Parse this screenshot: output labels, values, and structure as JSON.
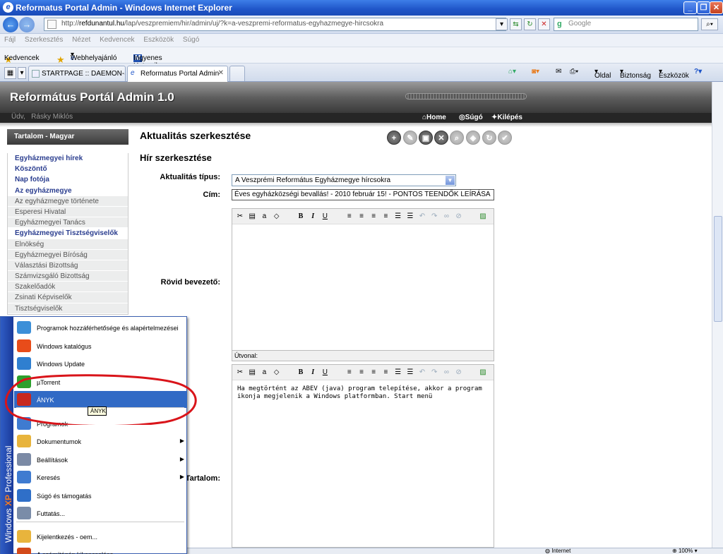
{
  "window": {
    "title": "Reformatus Portal Admin - Windows Internet Explorer"
  },
  "address": {
    "url_prefix": "http://",
    "url_host": "refdunantul.hu",
    "url_path": "/lap/veszpremiem/hir/admin/uj/?k=a-veszpremi-reformatus-egyhazmegye-hircsokra",
    "search_placeholder": "Google"
  },
  "menubar": [
    "Fájl",
    "Szerkesztés",
    "Nézet",
    "Kedvencek",
    "Eszközök",
    "Súgó"
  ],
  "favorites": {
    "label": "Kedvencek",
    "items": [
      "Webhelyajánló",
      "Ingyenes Hotmail"
    ]
  },
  "tabs": [
    {
      "label": "STARTPAGE :: DAEMON-Sea..."
    },
    {
      "label": "Reformatus Portal Admin"
    }
  ],
  "commandbar": [
    "Oldal",
    "Biztonság",
    "Eszközök"
  ],
  "portal": {
    "title": "Református Portál Admin 1.0",
    "greeting": "Üdv,",
    "user": "Rásky Miklós",
    "nav": [
      "Home",
      "Súgó",
      "Kilépés"
    ]
  },
  "sidebar": {
    "header": "Tartalom - Magyar",
    "items": [
      {
        "label": "Egyházmegyei hírek",
        "main": true
      },
      {
        "label": "Köszöntő",
        "main": true
      },
      {
        "label": "Nap fotója",
        "main": true
      },
      {
        "label": "Az egyházmegye",
        "main": true
      },
      {
        "label": "Az egyházmegye története",
        "main": false
      },
      {
        "label": "Esperesi Hivatal",
        "main": false
      },
      {
        "label": "Egyházmegyei Tanács",
        "main": false
      },
      {
        "label": "Egyházmegyei Tisztségviselők",
        "main": true
      },
      {
        "label": "Elnökség",
        "main": false
      },
      {
        "label": "Egyházmegyei Bíróság",
        "main": false
      },
      {
        "label": "Választási Bizottság",
        "main": false
      },
      {
        "label": "Számvizsgáló Bizottság",
        "main": false
      },
      {
        "label": "Szakelőadók",
        "main": false
      },
      {
        "label": "Zsinati Képviselők",
        "main": false
      },
      {
        "label": "Tisztségviselők",
        "main": false
      }
    ]
  },
  "content": {
    "title": "Aktualitás szerkesztése",
    "subtitle": "Hír szerkesztése",
    "type_label": "Aktualitás típus:",
    "type_value": "A Veszprémi Református Egyházmegye hírcsokra",
    "cim_label": "Cím:",
    "cim_value": "Éves egyházközségi bevallás! - 2010 február 15! - PONTOS TEENDŐK LEÍRÁSA",
    "intro_label": "Rövid bevezető:",
    "path_label": "Útvonal:",
    "content_label": "Tartalom:",
    "content_text": "Ha megtörtént az ABEV (java) program telepítése, akkor a program ikonja megjelenik a Windows platformban. Start menü"
  },
  "startmenu": {
    "brand_windows": "Windows",
    "brand_xp": "XP",
    "brand_edition": "Professional",
    "items": [
      {
        "label": "Programok hozzáférhetősége és alapértelmezései",
        "icon": "globe-icon"
      },
      {
        "label": "Windows katalógus",
        "icon": "windows-flag-icon"
      },
      {
        "label": "Windows Update",
        "icon": "windows-update-icon"
      },
      {
        "label": "µTorrent",
        "icon": "utorrent-icon"
      },
      {
        "label": "ÁNYK",
        "icon": "anyk-icon",
        "highlight": true
      },
      {
        "label": "Programok",
        "icon": "programs-icon"
      },
      {
        "label": "Dokumentumok",
        "icon": "documents-icon"
      },
      {
        "label": "Beállítások",
        "icon": "settings-icon"
      },
      {
        "label": "Keresés",
        "icon": "search-icon"
      },
      {
        "label": "Súgó és támogatás",
        "icon": "help-icon"
      },
      {
        "label": "Futtatás...",
        "icon": "run-icon"
      },
      {
        "label": "Kijelentkezés - oem...",
        "icon": "logoff-icon"
      },
      {
        "label": "A számítógép kikapcsolása...",
        "icon": "shutdown-icon"
      }
    ],
    "tooltip": "ÁNYK"
  },
  "statusbar": {
    "zone": "Internet",
    "zoom": "100%"
  },
  "colors": {
    "accent": "#316ac5",
    "annotation": "#d9141a",
    "sidebar_link": "#2a3d8f"
  }
}
